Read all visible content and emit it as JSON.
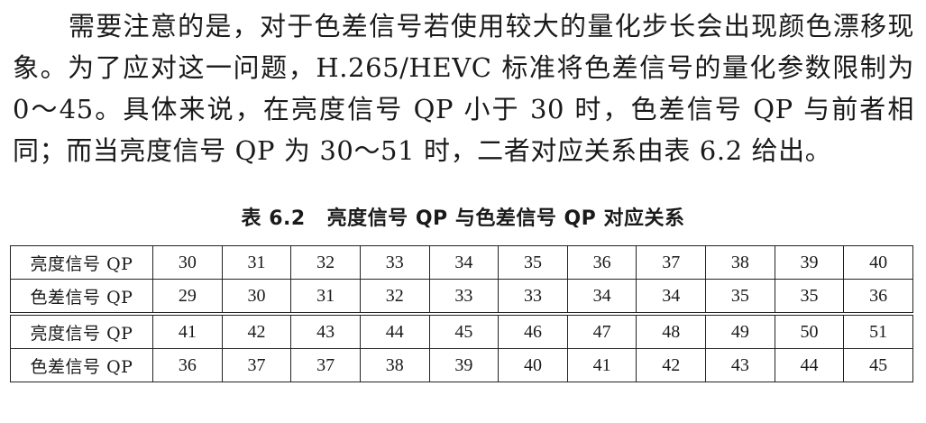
{
  "paragraph": "需要注意的是，对于色差信号若使用较大的量化步长会出现颜色漂移现象。为了应对这一问题，H.265/HEVC 标准将色差信号的量化参数限制为 0～45。具体来说，在亮度信号 QP 小于 30 时，色差信号 QP 与前者相同；而当亮度信号 QP 为 30～51 时，二者对应关系由表 6.2 给出。",
  "table_caption": {
    "number": "表 6.2",
    "title": "亮度信号 QP 与色差信号 QP 对应关系"
  },
  "table": {
    "luma_label": "亮度信号 QP",
    "chroma_label": "色差信号 QP",
    "rows": [
      {
        "luma": [
          "30",
          "31",
          "32",
          "33",
          "34",
          "35",
          "36",
          "37",
          "38",
          "39",
          "40"
        ],
        "chroma": [
          "29",
          "30",
          "31",
          "32",
          "33",
          "33",
          "34",
          "34",
          "35",
          "35",
          "36"
        ]
      },
      {
        "luma": [
          "41",
          "42",
          "43",
          "44",
          "45",
          "46",
          "47",
          "48",
          "49",
          "50",
          "51"
        ],
        "chroma": [
          "36",
          "37",
          "37",
          "38",
          "39",
          "40",
          "41",
          "42",
          "43",
          "44",
          "45"
        ]
      }
    ]
  }
}
